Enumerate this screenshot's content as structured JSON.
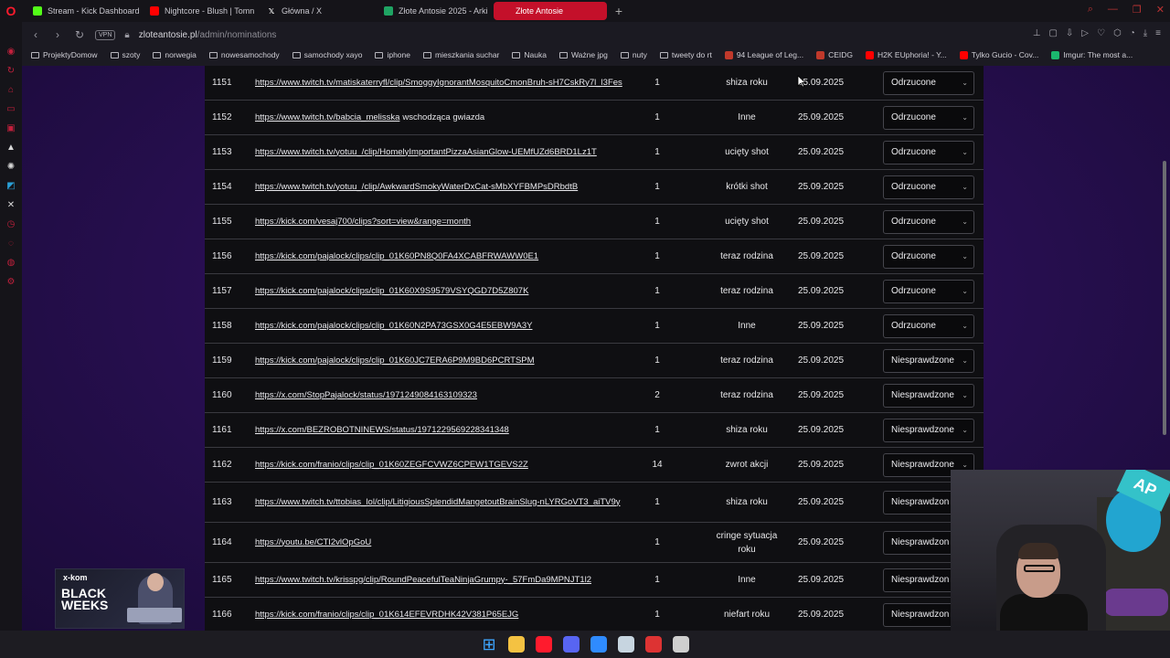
{
  "browser": {
    "tabs": [
      {
        "label": "Stream - Kick Dashboard",
        "icon": "kick-icon",
        "color": "#53fc18",
        "active": false
      },
      {
        "label": "Nightcore - Blush | Tomn",
        "icon": "youtube-icon",
        "color": "#ff0000",
        "active": false
      },
      {
        "label": "Główna / X",
        "icon": "x-icon",
        "color": "#ffffff",
        "active": false
      },
      {
        "label": "Złote Antosie 2025 - Arki",
        "icon": "sheets-icon",
        "color": "#1fa463",
        "active": false
      },
      {
        "label": "Złote Antosie",
        "icon": "site-icon",
        "color": "#ffffff",
        "active": true
      }
    ],
    "new_tab": "+",
    "address": {
      "vpn": "VPN",
      "host": "zloteantosie.pl",
      "path": "/admin/nominations"
    }
  },
  "bookmarks": [
    {
      "label": "ProjektyDomow",
      "icon": "folder-icon"
    },
    {
      "label": "szoty",
      "icon": "folder-icon"
    },
    {
      "label": "norwegia",
      "icon": "folder-icon"
    },
    {
      "label": "nowesamochody",
      "icon": "folder-icon"
    },
    {
      "label": "samochody xayo",
      "icon": "folder-icon"
    },
    {
      "label": "iphone",
      "icon": "folder-icon"
    },
    {
      "label": "mieszkania suchar",
      "icon": "folder-icon"
    },
    {
      "label": "Nauka",
      "icon": "folder-icon"
    },
    {
      "label": "Ważne jpg",
      "icon": "folder-icon"
    },
    {
      "label": "nuty",
      "icon": "folder-icon"
    },
    {
      "label": "tweety do rt",
      "icon": "folder-icon"
    },
    {
      "label": "94 League of Leg...",
      "icon": "lol-icon",
      "color": "#c0392b"
    },
    {
      "label": "CEIDG",
      "icon": "ceidg-icon",
      "color": "#c0392b"
    },
    {
      "label": "H2K EUphoria! - Y...",
      "icon": "youtube-icon",
      "color": "#ff0000"
    },
    {
      "label": "Tylko Gucio - Cov...",
      "icon": "youtube-icon",
      "color": "#ff0000"
    },
    {
      "label": "Imgur: The most a...",
      "icon": "imgur-icon",
      "color": "#1bb76e"
    }
  ],
  "nominations": [
    {
      "id": "1151",
      "link": "https://www.twitch.tv/matiskaterryfl/clip/SmoggyIgnorantMosquitoCmonBruh-sH7CskRy7l_l3Fes",
      "note": "",
      "count": "1",
      "category": "shiza roku",
      "date": "25.09.2025",
      "status": "Odrzucone"
    },
    {
      "id": "1152",
      "link": "https://www.twitch.tv/babcia_melisska",
      "note": "wschodząca gwiazda",
      "count": "1",
      "category": "Inne",
      "date": "25.09.2025",
      "status": "Odrzucone"
    },
    {
      "id": "1153",
      "link": "https://www.twitch.tv/yotuu_/clip/HomelyImportantPizzaAsianGlow-UEMfUZd6BRD1Lz1T",
      "note": "",
      "count": "1",
      "category": "ucięty shot",
      "date": "25.09.2025",
      "status": "Odrzucone"
    },
    {
      "id": "1154",
      "link": "https://www.twitch.tv/yotuu_/clip/AwkwardSmokyWaterDxCat-sMbXYFBMPsDRbdtB",
      "note": "",
      "count": "1",
      "category": "krótki shot",
      "date": "25.09.2025",
      "status": "Odrzucone"
    },
    {
      "id": "1155",
      "link": "https://kick.com/vesaj700/clips?sort=view&range=month",
      "note": "",
      "count": "1",
      "category": "ucięty shot",
      "date": "25.09.2025",
      "status": "Odrzucone"
    },
    {
      "id": "1156",
      "link": "https://kick.com/pajalock/clips/clip_01K60PN8Q0FA4XCABFRWAWW0E1",
      "note": "",
      "count": "1",
      "category": "teraz rodzina",
      "date": "25.09.2025",
      "status": "Odrzucone"
    },
    {
      "id": "1157",
      "link": "https://kick.com/pajalock/clips/clip_01K60X9S9579VSYQGD7D5Z807K",
      "note": "",
      "count": "1",
      "category": "teraz rodzina",
      "date": "25.09.2025",
      "status": "Odrzucone"
    },
    {
      "id": "1158",
      "link": "https://kick.com/pajalock/clips/clip_01K60N2PA73GSX0G4E5EBW9A3Y",
      "note": "",
      "count": "1",
      "category": "Inne",
      "date": "25.09.2025",
      "status": "Odrzucone"
    },
    {
      "id": "1159",
      "link": "https://kick.com/pajalock/clips/clip_01K60JC7ERA6P9M9BD6PCRTSPM",
      "note": "",
      "count": "1",
      "category": "teraz rodzina",
      "date": "25.09.2025",
      "status": "Niesprawdzone"
    },
    {
      "id": "1160",
      "link": "https://x.com/StopPajalock/status/1971249084163109323",
      "note": "",
      "count": "2",
      "category": "teraz rodzina",
      "date": "25.09.2025",
      "status": "Niesprawdzone"
    },
    {
      "id": "1161",
      "link": "https://x.com/BEZROBOTNINEWS/status/1971229569228341348",
      "note": "",
      "count": "1",
      "category": "shiza roku",
      "date": "25.09.2025",
      "status": "Niesprawdzone"
    },
    {
      "id": "1162",
      "link": "https://kick.com/franio/clips/clip_01K60ZEGFCVWZ6CPEW1TGEVS2Z",
      "note": "",
      "count": "14",
      "category": "zwrot akcji",
      "date": "25.09.2025",
      "status": "Niesprawdzone"
    },
    {
      "id": "1163",
      "link": "https://www.twitch.tv/ttobias_lol/clip/LitigiousSplendidMangetoutBrainSlug-nLYRGoVT3_aiTV9y",
      "note": "",
      "count": "1",
      "category": "shiza roku",
      "date": "25.09.2025",
      "status": "Niesprawdzon"
    },
    {
      "id": "1164",
      "link": "https://youtu.be/CTI2vlOpGoU",
      "note": "",
      "count": "1",
      "category": "cringe sytuacja roku",
      "date": "25.09.2025",
      "status": "Niesprawdzon"
    },
    {
      "id": "1165",
      "link": "https://www.twitch.tv/krisspg/clip/RoundPeacefulTeaNinjaGrumpy-_57FmDa9MPNJT1l2",
      "note": "",
      "count": "1",
      "category": "Inne",
      "date": "25.09.2025",
      "status": "Niesprawdzon"
    },
    {
      "id": "1166",
      "link": "https://kick.com/franio/clips/clip_01K614EFEVRDHK42V381P65EJG",
      "note": "",
      "count": "1",
      "category": "niefart roku",
      "date": "25.09.2025",
      "status": "Niesprawdzon"
    }
  ],
  "ad": {
    "brand": "x-kom",
    "headline": "BLACK WEEKS"
  },
  "webcam": {
    "banner": "AP"
  },
  "taskbar": [
    {
      "icon": "windows-start-icon",
      "color": "#3ea6ff"
    },
    {
      "icon": "file-explorer-icon",
      "color": "#f4c242"
    },
    {
      "icon": "opera-icon",
      "color": "#ff1b2d"
    },
    {
      "icon": "discord-icon",
      "color": "#5865f2"
    },
    {
      "icon": "messenger-icon",
      "color": "#2f8bff"
    },
    {
      "icon": "steam-icon",
      "color": "#c7d5e0"
    },
    {
      "icon": "game-launcher-icon",
      "color": "#d33"
    },
    {
      "icon": "settings-icon",
      "color": "#cfcfcf"
    }
  ]
}
